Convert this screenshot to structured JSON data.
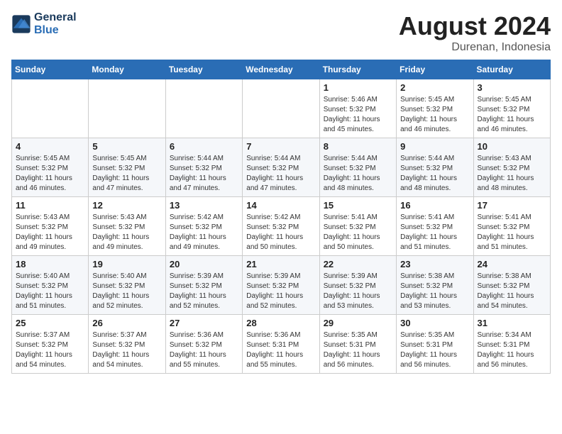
{
  "header": {
    "logo_line1": "General",
    "logo_line2": "Blue",
    "month_year": "August 2024",
    "location": "Durenan, Indonesia"
  },
  "weekdays": [
    "Sunday",
    "Monday",
    "Tuesday",
    "Wednesday",
    "Thursday",
    "Friday",
    "Saturday"
  ],
  "weeks": [
    [
      {
        "day": "",
        "info": ""
      },
      {
        "day": "",
        "info": ""
      },
      {
        "day": "",
        "info": ""
      },
      {
        "day": "",
        "info": ""
      },
      {
        "day": "1",
        "info": "Sunrise: 5:46 AM\nSunset: 5:32 PM\nDaylight: 11 hours\nand 45 minutes."
      },
      {
        "day": "2",
        "info": "Sunrise: 5:45 AM\nSunset: 5:32 PM\nDaylight: 11 hours\nand 46 minutes."
      },
      {
        "day": "3",
        "info": "Sunrise: 5:45 AM\nSunset: 5:32 PM\nDaylight: 11 hours\nand 46 minutes."
      }
    ],
    [
      {
        "day": "4",
        "info": "Sunrise: 5:45 AM\nSunset: 5:32 PM\nDaylight: 11 hours\nand 46 minutes."
      },
      {
        "day": "5",
        "info": "Sunrise: 5:45 AM\nSunset: 5:32 PM\nDaylight: 11 hours\nand 47 minutes."
      },
      {
        "day": "6",
        "info": "Sunrise: 5:44 AM\nSunset: 5:32 PM\nDaylight: 11 hours\nand 47 minutes."
      },
      {
        "day": "7",
        "info": "Sunrise: 5:44 AM\nSunset: 5:32 PM\nDaylight: 11 hours\nand 47 minutes."
      },
      {
        "day": "8",
        "info": "Sunrise: 5:44 AM\nSunset: 5:32 PM\nDaylight: 11 hours\nand 48 minutes."
      },
      {
        "day": "9",
        "info": "Sunrise: 5:44 AM\nSunset: 5:32 PM\nDaylight: 11 hours\nand 48 minutes."
      },
      {
        "day": "10",
        "info": "Sunrise: 5:43 AM\nSunset: 5:32 PM\nDaylight: 11 hours\nand 48 minutes."
      }
    ],
    [
      {
        "day": "11",
        "info": "Sunrise: 5:43 AM\nSunset: 5:32 PM\nDaylight: 11 hours\nand 49 minutes."
      },
      {
        "day": "12",
        "info": "Sunrise: 5:43 AM\nSunset: 5:32 PM\nDaylight: 11 hours\nand 49 minutes."
      },
      {
        "day": "13",
        "info": "Sunrise: 5:42 AM\nSunset: 5:32 PM\nDaylight: 11 hours\nand 49 minutes."
      },
      {
        "day": "14",
        "info": "Sunrise: 5:42 AM\nSunset: 5:32 PM\nDaylight: 11 hours\nand 50 minutes."
      },
      {
        "day": "15",
        "info": "Sunrise: 5:41 AM\nSunset: 5:32 PM\nDaylight: 11 hours\nand 50 minutes."
      },
      {
        "day": "16",
        "info": "Sunrise: 5:41 AM\nSunset: 5:32 PM\nDaylight: 11 hours\nand 51 minutes."
      },
      {
        "day": "17",
        "info": "Sunrise: 5:41 AM\nSunset: 5:32 PM\nDaylight: 11 hours\nand 51 minutes."
      }
    ],
    [
      {
        "day": "18",
        "info": "Sunrise: 5:40 AM\nSunset: 5:32 PM\nDaylight: 11 hours\nand 51 minutes."
      },
      {
        "day": "19",
        "info": "Sunrise: 5:40 AM\nSunset: 5:32 PM\nDaylight: 11 hours\nand 52 minutes."
      },
      {
        "day": "20",
        "info": "Sunrise: 5:39 AM\nSunset: 5:32 PM\nDaylight: 11 hours\nand 52 minutes."
      },
      {
        "day": "21",
        "info": "Sunrise: 5:39 AM\nSunset: 5:32 PM\nDaylight: 11 hours\nand 52 minutes."
      },
      {
        "day": "22",
        "info": "Sunrise: 5:39 AM\nSunset: 5:32 PM\nDaylight: 11 hours\nand 53 minutes."
      },
      {
        "day": "23",
        "info": "Sunrise: 5:38 AM\nSunset: 5:32 PM\nDaylight: 11 hours\nand 53 minutes."
      },
      {
        "day": "24",
        "info": "Sunrise: 5:38 AM\nSunset: 5:32 PM\nDaylight: 11 hours\nand 54 minutes."
      }
    ],
    [
      {
        "day": "25",
        "info": "Sunrise: 5:37 AM\nSunset: 5:32 PM\nDaylight: 11 hours\nand 54 minutes."
      },
      {
        "day": "26",
        "info": "Sunrise: 5:37 AM\nSunset: 5:32 PM\nDaylight: 11 hours\nand 54 minutes."
      },
      {
        "day": "27",
        "info": "Sunrise: 5:36 AM\nSunset: 5:32 PM\nDaylight: 11 hours\nand 55 minutes."
      },
      {
        "day": "28",
        "info": "Sunrise: 5:36 AM\nSunset: 5:31 PM\nDaylight: 11 hours\nand 55 minutes."
      },
      {
        "day": "29",
        "info": "Sunrise: 5:35 AM\nSunset: 5:31 PM\nDaylight: 11 hours\nand 56 minutes."
      },
      {
        "day": "30",
        "info": "Sunrise: 5:35 AM\nSunset: 5:31 PM\nDaylight: 11 hours\nand 56 minutes."
      },
      {
        "day": "31",
        "info": "Sunrise: 5:34 AM\nSunset: 5:31 PM\nDaylight: 11 hours\nand 56 minutes."
      }
    ]
  ]
}
